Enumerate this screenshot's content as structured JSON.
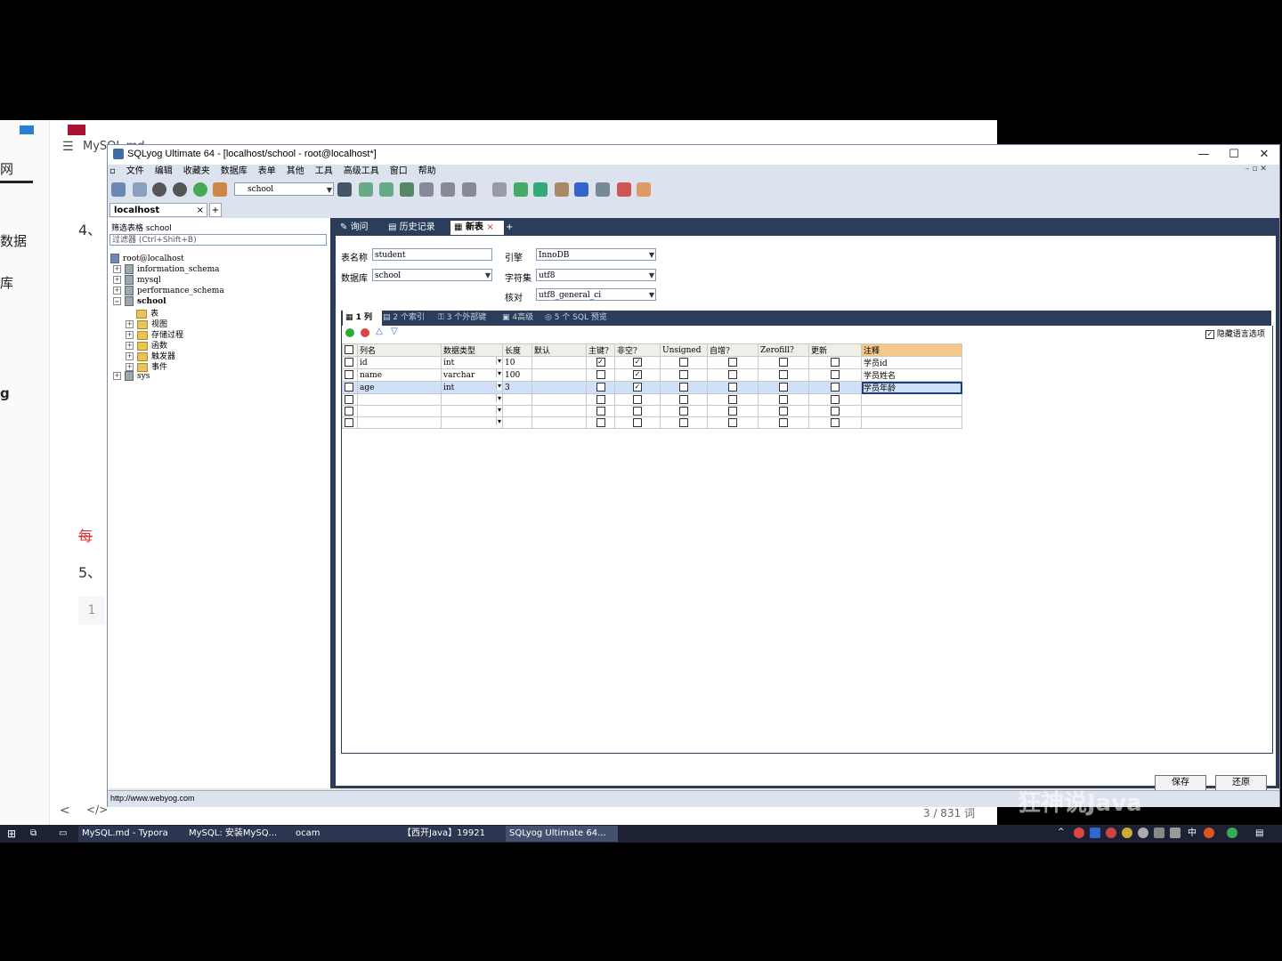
{
  "background_doc": {
    "header": "MySQL.md",
    "sidebar_fragments": [
      "网",
      "数据",
      "库",
      "g"
    ],
    "section_4": "4、",
    "section_5": "5、",
    "red_text": "每",
    "code_line_number": "1",
    "word_count": "3 / 831 词"
  },
  "window": {
    "title": "SQLyog Ultimate 64 - [localhost/school - root@localhost*]",
    "controls": {
      "minimize": "—",
      "maximize": "☐",
      "close": "✕"
    }
  },
  "menu": [
    "文件",
    "编辑",
    "收藏夹",
    "数据库",
    "表单",
    "其他",
    "工具",
    "高级工具",
    "窗口",
    "帮助"
  ],
  "toolbar": {
    "db_select": "school"
  },
  "connection_tab": {
    "label": "localhost",
    "close": "×",
    "add": "+"
  },
  "object_browser": {
    "filter_label": "筛选表格 school",
    "filter_placeholder": "过滤器 (Ctrl+Shift+B)",
    "root": "root@localhost",
    "databases": [
      "information_schema",
      "mysql",
      "performance_schema",
      "school",
      "sys"
    ],
    "school_children": [
      "表",
      "视图",
      "存储过程",
      "函数",
      "触发器",
      "事件"
    ]
  },
  "query_tabs": [
    {
      "label": "询问",
      "active": false
    },
    {
      "label": "历史记录",
      "active": false
    },
    {
      "label": "新表",
      "active": true
    }
  ],
  "form": {
    "table_name_label": "表名称",
    "table_name": "student",
    "database_label": "数据库",
    "database": "school",
    "engine_label": "引擎",
    "engine": "InnoDB",
    "charset_label": "字符集",
    "charset": "utf8",
    "collation_label": "核对",
    "collation": "utf8_general_ci"
  },
  "sub_tabs": [
    "1 列",
    "2 个索引",
    "3 个外部键",
    "4高级",
    "5 个 SQL 预览"
  ],
  "hide_language_options": "隐藏语言选项",
  "columns_table": {
    "headers": [
      "列名",
      "数据类型",
      "长度",
      "默认",
      "主键?",
      "非空?",
      "Unsigned",
      "自增?",
      "Zerofill?",
      "更新",
      "注释"
    ],
    "rows": [
      {
        "name": "id",
        "type": "int",
        "length": "10",
        "default": "",
        "pk": true,
        "notnull": true,
        "unsigned": false,
        "autoinc": false,
        "zerofill": false,
        "update": false,
        "comment": "学员id"
      },
      {
        "name": "name",
        "type": "varchar",
        "length": "100",
        "default": "",
        "pk": false,
        "notnull": true,
        "unsigned": false,
        "autoinc": false,
        "zerofill": false,
        "update": false,
        "comment": "学员姓名"
      },
      {
        "name": "age",
        "type": "int",
        "length": "3",
        "default": "",
        "pk": false,
        "notnull": true,
        "unsigned": false,
        "autoinc": false,
        "zerofill": false,
        "update": false,
        "comment": "学员年龄"
      },
      {
        "name": "",
        "type": "",
        "length": "",
        "default": "",
        "pk": false,
        "notnull": false,
        "unsigned": false,
        "autoinc": false,
        "zerofill": false,
        "update": false,
        "comment": ""
      },
      {
        "name": "",
        "type": "",
        "length": "",
        "default": "",
        "pk": false,
        "notnull": false,
        "unsigned": false,
        "autoinc": false,
        "zerofill": false,
        "update": false,
        "comment": ""
      },
      {
        "name": "",
        "type": "",
        "length": "",
        "default": "",
        "pk": false,
        "notnull": false,
        "unsigned": false,
        "autoinc": false,
        "zerofill": false,
        "update": false,
        "comment": ""
      }
    ]
  },
  "buttons": {
    "save": "保存",
    "revert": "还原"
  },
  "status_url": "http://www.webyog.com",
  "watermark": "狂神说Java",
  "taskbar": [
    "MySQL.md - Typora",
    "MySQL: 安装MySQ...",
    "ocam",
    "【西开Java】19921",
    "SQLyog Ultimate 64..."
  ],
  "tray_ime": "中"
}
